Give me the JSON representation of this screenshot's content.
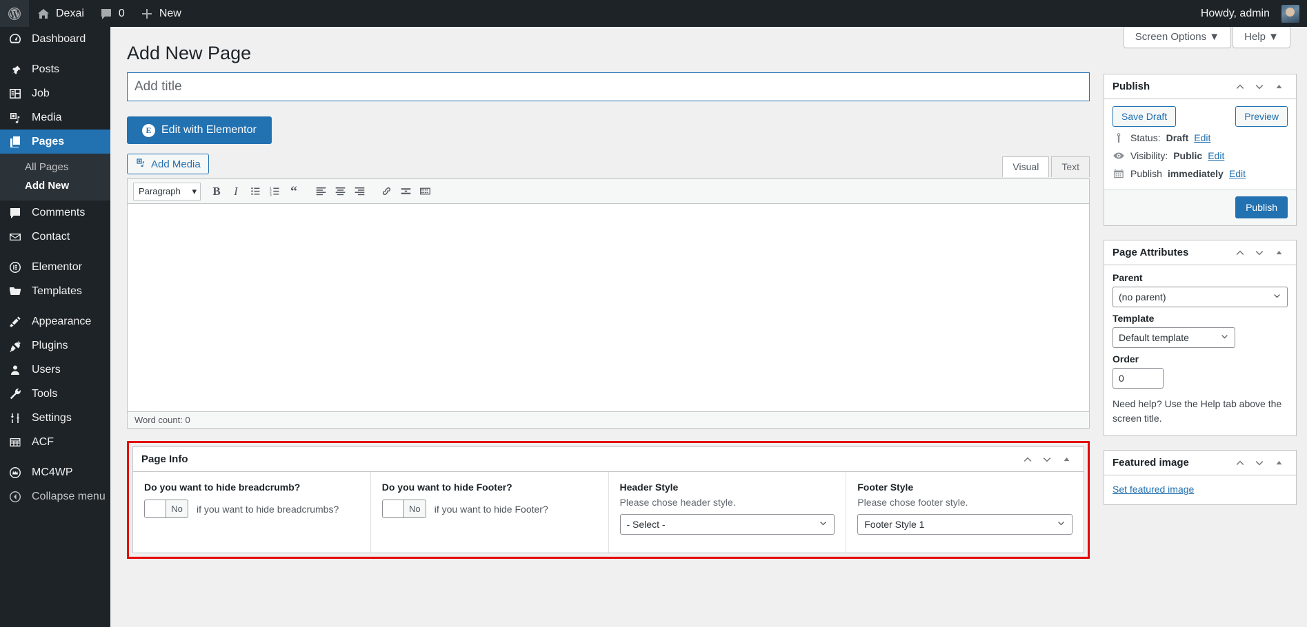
{
  "adminbar": {
    "logo_icon": "wordpress-logo-icon",
    "site_name": "Dexai",
    "home_icon": "home-icon",
    "comments_icon": "comment-bubble-icon",
    "comment_count": "0",
    "new_icon": "plus-icon",
    "new_label": "New",
    "howdy": "Howdy, admin",
    "avatar_icon": "avatar"
  },
  "screen_meta": {
    "screen_options": "Screen Options",
    "help": "Help",
    "caret": "▼"
  },
  "sidebar": {
    "items": [
      {
        "label": "Dashboard",
        "icon": "dashboard-icon",
        "current": false,
        "sep_before": false
      },
      {
        "label": "Posts",
        "icon": "pin-icon",
        "current": false,
        "sep_before": true
      },
      {
        "label": "Job",
        "icon": "list-view-icon",
        "current": false,
        "sep_before": false
      },
      {
        "label": "Media",
        "icon": "media-icon",
        "current": false,
        "sep_before": false
      },
      {
        "label": "Pages",
        "icon": "pages-icon",
        "current": true,
        "sep_before": false
      },
      {
        "label": "Comments",
        "icon": "comment-bubble-icon",
        "current": false,
        "sep_before": false
      },
      {
        "label": "Contact",
        "icon": "envelope-icon",
        "current": false,
        "sep_before": false
      },
      {
        "label": "Elementor",
        "icon": "elementor-icon",
        "current": false,
        "sep_before": true
      },
      {
        "label": "Templates",
        "icon": "folder-icon",
        "current": false,
        "sep_before": false
      },
      {
        "label": "Appearance",
        "icon": "paintbrush-icon",
        "current": false,
        "sep_before": true
      },
      {
        "label": "Plugins",
        "icon": "plug-icon",
        "current": false,
        "sep_before": false
      },
      {
        "label": "Users",
        "icon": "user-icon",
        "current": false,
        "sep_before": false
      },
      {
        "label": "Tools",
        "icon": "wrench-icon",
        "current": false,
        "sep_before": false
      },
      {
        "label": "Settings",
        "icon": "sliders-icon",
        "current": false,
        "sep_before": false
      },
      {
        "label": "ACF",
        "icon": "grid-icon",
        "current": false,
        "sep_before": false
      },
      {
        "label": "MC4WP",
        "icon": "mailchimp-icon",
        "current": false,
        "sep_before": true
      },
      {
        "label": "Collapse menu",
        "icon": "collapse-arrow-icon",
        "current": false,
        "sep_before": false
      }
    ],
    "submenu": [
      {
        "label": "All Pages",
        "current": false
      },
      {
        "label": "Add New",
        "current": true
      }
    ]
  },
  "page": {
    "title": "Add New Page",
    "title_placeholder": "Add title",
    "title_value": ""
  },
  "elementor": {
    "button_label": "Edit with Elementor",
    "badge": "E"
  },
  "editor": {
    "add_media_label": "Add Media",
    "add_media_icon": "media-icon",
    "tabs": [
      {
        "label": "Visual",
        "active": true
      },
      {
        "label": "Text",
        "active": false
      }
    ],
    "format_select": "Paragraph",
    "toolbar_icons": [
      "bold-icon",
      "italic-icon",
      "bulleted-list-icon",
      "numbered-list-icon",
      "blockquote-icon",
      "align-left-icon",
      "align-center-icon",
      "align-right-icon",
      "link-icon",
      "read-more-icon",
      "toolbar-toggle-icon"
    ],
    "body_value": "",
    "word_count": "Word count: 0"
  },
  "pageinfo": {
    "title": "Page Info",
    "highlight_color": "#e60000",
    "handle_icons": [
      "chevron-up-icon",
      "chevron-down-icon",
      "toggle-triangle-icon"
    ],
    "fields": [
      {
        "label": "Do you want to hide breadcrumb?",
        "type": "switch",
        "value": "No",
        "hint": "if you want to hide breadcrumbs?"
      },
      {
        "label": "Do you want to hide Footer?",
        "type": "switch",
        "value": "No",
        "hint": "if you want to hide Footer?"
      },
      {
        "label": "Header Style",
        "type": "select",
        "instructions": "Please chose header style.",
        "value": "- Select -"
      },
      {
        "label": "Footer Style",
        "type": "select",
        "instructions": "Please chose footer style.",
        "value": "Footer Style 1"
      }
    ]
  },
  "publish_box": {
    "title": "Publish",
    "handle_icons": [
      "chevron-up-icon",
      "chevron-down-icon",
      "toggle-triangle-icon"
    ],
    "save_draft": "Save Draft",
    "preview": "Preview",
    "status_icon": "post-status-icon",
    "status_label": "Status:",
    "status_value": "Draft",
    "status_edit": "Edit",
    "visibility_icon": "eye-icon",
    "visibility_label": "Visibility:",
    "visibility_value": "Public",
    "visibility_edit": "Edit",
    "schedule_icon": "calendar-icon",
    "schedule_label": "Publish",
    "schedule_value": "immediately",
    "schedule_edit": "Edit",
    "publish_button": "Publish"
  },
  "page_attributes": {
    "title": "Page Attributes",
    "handle_icons": [
      "chevron-up-icon",
      "chevron-down-icon",
      "toggle-triangle-icon"
    ],
    "parent_label": "Parent",
    "parent_value": "(no parent)",
    "template_label": "Template",
    "template_value": "Default template",
    "order_label": "Order",
    "order_value": "0",
    "help_text": "Need help? Use the Help tab above the screen title."
  },
  "featured_image": {
    "title": "Featured image",
    "handle_icons": [
      "chevron-up-icon",
      "chevron-down-icon",
      "toggle-triangle-icon"
    ],
    "set_link": "Set featured image"
  }
}
